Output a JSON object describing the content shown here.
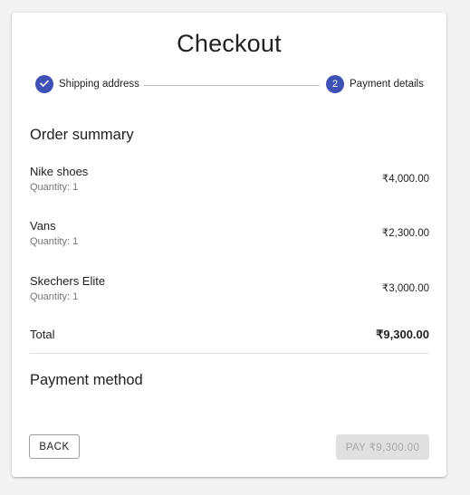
{
  "checkout": {
    "title": "Checkout"
  },
  "stepper": {
    "steps": [
      {
        "label": "Shipping address",
        "state": "completed",
        "icon": "check-icon"
      },
      {
        "label": "Payment details",
        "state": "active",
        "number": "2"
      }
    ],
    "active_color": "#3f51b5"
  },
  "order_summary": {
    "heading": "Order summary",
    "items": [
      {
        "name": "Nike shoes",
        "quantity": "Quantity: 1",
        "price": "₹4,000.00"
      },
      {
        "name": "Vans",
        "quantity": "Quantity: 1",
        "price": "₹2,300.00"
      },
      {
        "name": "Skechers Elite",
        "quantity": "Quantity: 1",
        "price": "₹3,000.00"
      }
    ],
    "total_label": "Total",
    "total_amount": "₹9,300.00"
  },
  "payment": {
    "heading": "Payment method"
  },
  "actions": {
    "back_label": "BACK",
    "pay_label": "PAY ₹9,300.00",
    "pay_disabled": true
  }
}
